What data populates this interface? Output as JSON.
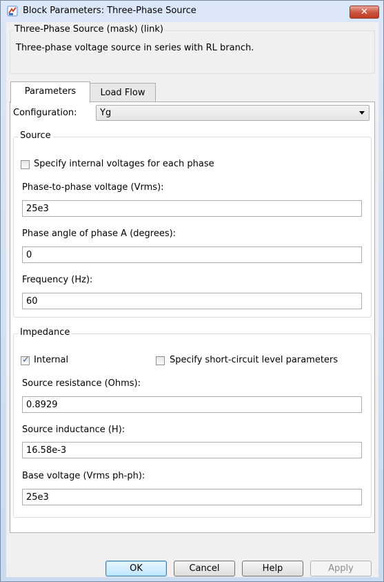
{
  "window": {
    "title": "Block Parameters: Three-Phase Source",
    "close_glyph": "✕"
  },
  "description": {
    "legend": "Three-Phase Source (mask) (link)",
    "text": "Three-phase voltage source in series with RL branch."
  },
  "tabs": [
    {
      "label": "Parameters",
      "active": true
    },
    {
      "label": "Load Flow",
      "active": false
    }
  ],
  "configuration": {
    "label": "Configuration:",
    "value": "Yg"
  },
  "source": {
    "legend": "Source",
    "specify_internal": {
      "label": "Specify internal voltages for each phase",
      "checked": false
    },
    "phase_voltage": {
      "label": "Phase-to-phase voltage (Vrms):",
      "value": "25e3"
    },
    "phase_angle": {
      "label": "Phase angle of phase A (degrees):",
      "value": "0"
    },
    "frequency": {
      "label": "Frequency (Hz):",
      "value": "60"
    }
  },
  "impedance": {
    "legend": "Impedance",
    "internal": {
      "label": "Internal",
      "checked": true
    },
    "short_circuit": {
      "label": "Specify short-circuit level parameters",
      "checked": false
    },
    "resistance": {
      "label": "Source resistance (Ohms):",
      "value": "0.8929"
    },
    "inductance": {
      "label": "Source inductance (H):",
      "value": "16.58e-3"
    },
    "base_voltage": {
      "label": "Base voltage (Vrms ph-ph):",
      "value": "25e3"
    }
  },
  "buttons": {
    "ok": "OK",
    "cancel": "Cancel",
    "help": "Help",
    "apply": "Apply"
  },
  "icons": {
    "app": "simulink-block-icon",
    "close": "close-icon"
  },
  "colors": {
    "titlebar": "#c9dbf1",
    "close_button": "#c7543e",
    "checkmark": "#3c5f97",
    "default_button": "#bee6fd"
  }
}
